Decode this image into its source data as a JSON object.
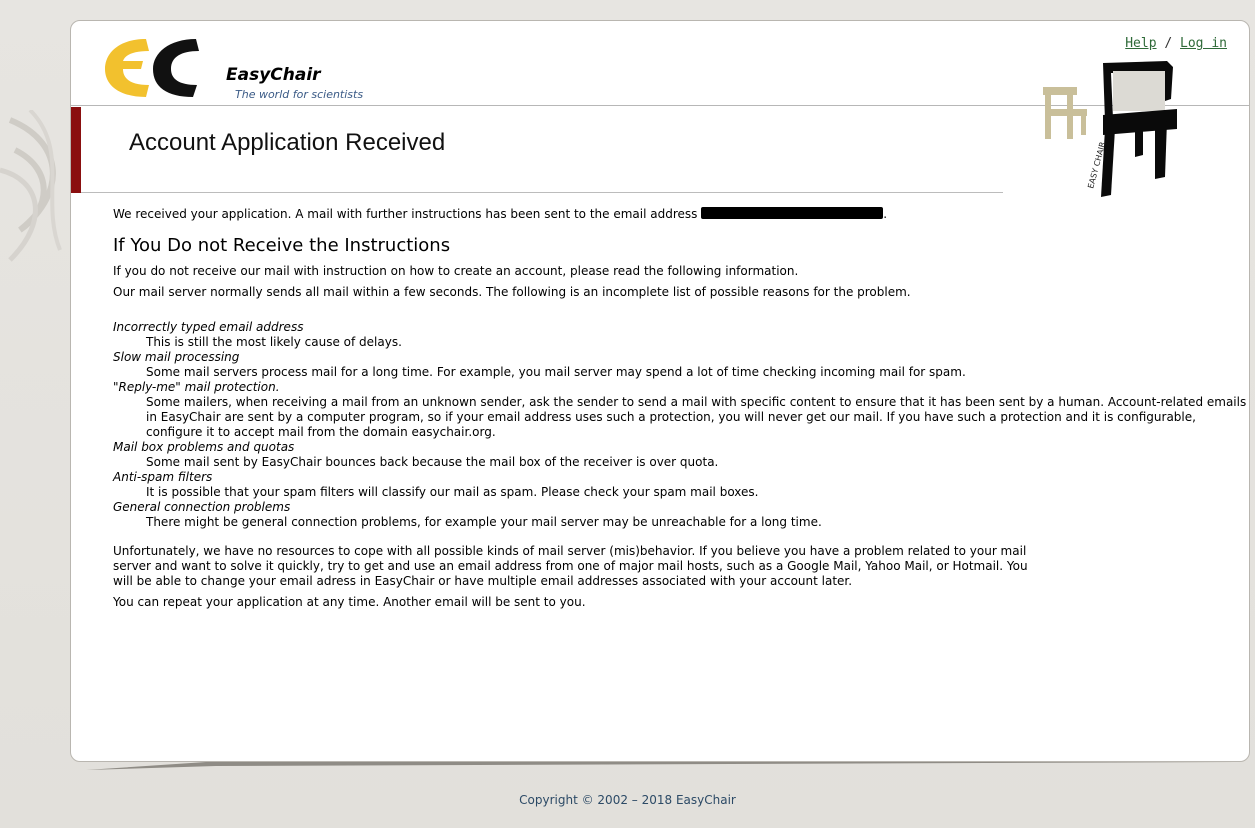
{
  "header": {
    "logo_name": "EasyChair",
    "logo_tagline": "The world for scientists",
    "help_link": "Help",
    "separator": "/",
    "login_link": "Log in"
  },
  "page": {
    "title": "Account Application Received",
    "intro": "We received your application. A mail with further instructions has been sent to the email address",
    "intro_end": ".",
    "section_heading": "If You Do not Receive the Instructions",
    "para1": "If you do not receive our mail with instruction on how to create an account, please read the following information.",
    "para2": "Our mail server normally sends all mail within a few seconds. The following is an incomplete list of possible reasons for the problem.",
    "reasons": [
      {
        "term": "Incorrectly typed email address",
        "desc": "This is still the most likely cause of delays."
      },
      {
        "term": "Slow mail processing",
        "desc": "Some mail servers process mail for a long time. For example, you mail server may spend a lot of time checking incoming mail for spam."
      },
      {
        "term": "\"Reply-me\" mail protection.",
        "desc": "Some mailers, when receiving a mail from an unknown sender, ask the sender to send a mail with specific content to ensure that it has been sent by a human. Account-related emails in EasyChair are sent by a computer program, so if your email address uses such a protection, you will never get our mail. If you have such a protection and it is configurable, configure it to accept mail from the domain easychair.org."
      },
      {
        "term": "Mail box problems and quotas",
        "desc": "Some mail sent by EasyChair bounces back because the mail box of the receiver is over quota."
      },
      {
        "term": "Anti-spam filters",
        "desc": "It is possible that your spam filters will classify our mail as spam. Please check your spam mail boxes."
      },
      {
        "term": "General connection problems",
        "desc": "There might be general connection problems, for example your mail server may be unreachable for a long time."
      }
    ],
    "para3": "Unfortunately, we have no resources to cope with all possible kinds of mail server (mis)behavior. If you believe you have a problem related to your mail server and want to solve it quickly, try to get and use an email address from one of major mail hosts, such as a Google Mail, Yahoo Mail, or Hotmail. You will be able to change your email adress in EasyChair or have multiple email addresses associated with your account later.",
    "para4": "You can repeat your application at any time. Another email will be sent to you."
  },
  "footer": {
    "copyright": "Copyright © 2002 – 2018 EasyChair"
  },
  "colors": {
    "brand_yellow": "#f2c12e",
    "title_bar": "#8a0f0f",
    "link_green": "#2e6a38",
    "footer_text": "#2c4a66"
  },
  "icons": [
    "easychair-logo",
    "chairs-illustration",
    "background-swirl"
  ]
}
